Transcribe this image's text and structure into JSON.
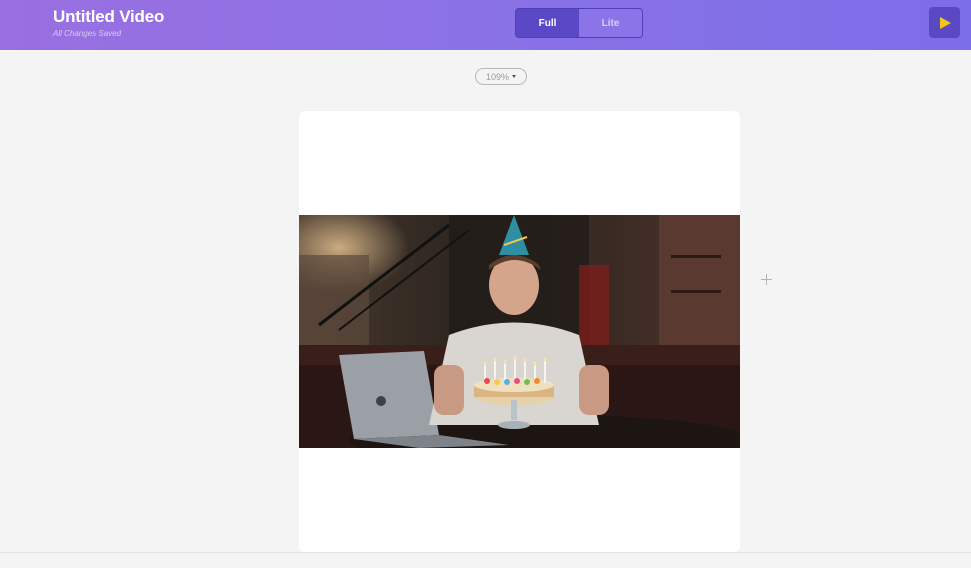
{
  "header": {
    "title": "Untitled Video",
    "save_status": "All Changes Saved",
    "modes": [
      {
        "label": "Full",
        "active": true
      },
      {
        "label": "Lite",
        "active": false
      }
    ],
    "play_icon": "play-icon",
    "play_color": "#f5c518"
  },
  "canvas": {
    "zoom": "109%",
    "scene": "birthday-video-still",
    "add_icon": "plus-icon"
  },
  "colors": {
    "header_start": "#9a6fe0",
    "header_end": "#7c6ee8",
    "toggle_active": "#5a48c6",
    "background": "#f4f4f4"
  }
}
